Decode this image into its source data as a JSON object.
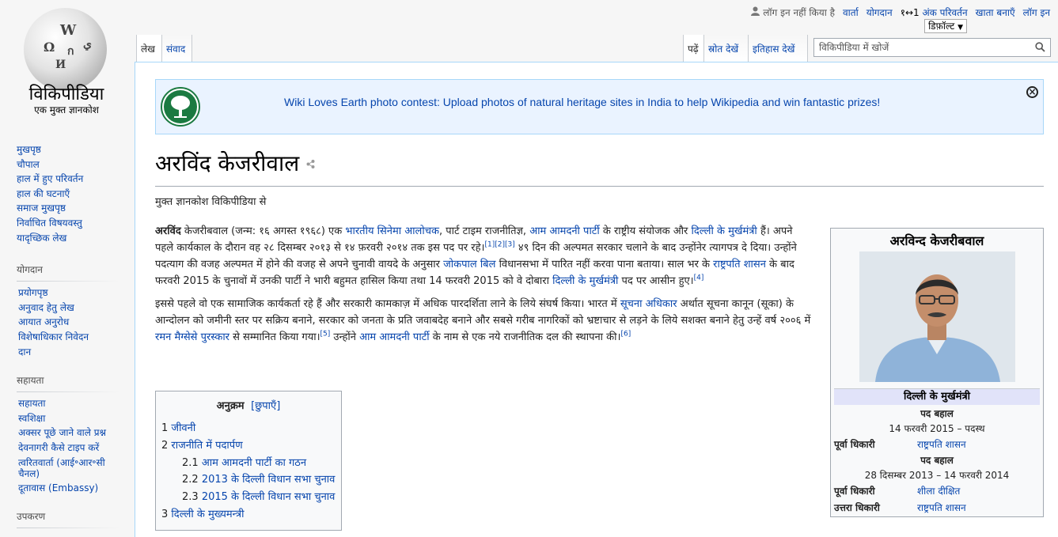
{
  "logo": {
    "wordmark": "विकिपीडिया",
    "tagline": "एक मुक्त ज्ञानकोश",
    "glyphs": [
      "W",
      "Ω",
      "ก",
      "ي",
      "И"
    ]
  },
  "personal": {
    "not_logged_in": "लॉग इन नहीं किया है",
    "talk": "वार्ता",
    "contributions": "योगदान",
    "digit_toggle": "१↔1",
    "digit_change": "अंक परिवर्तन",
    "create_account": "खाता बनाएँ",
    "log_in": "लॉग इन",
    "default_select": "डिफ़ॉल्ट"
  },
  "tabs": {
    "article": "लेख",
    "talk": "संवाद",
    "read": "पढ़ें",
    "view_source": "स्रोत देखें",
    "history": "इतिहास देखें"
  },
  "search": {
    "placeholder": "विकिपीडिया में खोजें"
  },
  "sidebar": {
    "main_items": [
      "मुखपृष्ठ",
      "चौपाल",
      "हाल में हुए परिवर्तन",
      "हाल की घटनाएँ",
      "समाज मुखपृष्ठ",
      "निर्वाचित विषयवस्तु",
      "यादृच्छिक लेख"
    ],
    "contribute_heading": "योगदान",
    "contribute_items": [
      "प्रयोगपृष्ठ",
      "अनुवाद हेतु लेख",
      "आयात अनुरोध",
      "विशेषाधिकार निवेदन",
      "दान"
    ],
    "help_heading": "सहायता",
    "help_items": [
      "सहायता",
      "स्वशिक्षा",
      "अक्सर पूछे जाने वाले प्रश्न",
      "देवनागरी कैसे टाइप करें",
      "त्वरितवार्ता (आई॰आर॰सी चैनल)",
      "दूतावास (Embassy)"
    ],
    "tools_heading": "उपकरण"
  },
  "banner": {
    "text": "Wiki Loves Earth photo contest: Upload photos of natural heritage sites in India to help Wikipedia and win fantastic prizes!"
  },
  "article": {
    "title": "अरविंद केजरीवाल",
    "site_sub": "मुक्त ज्ञानकोश विकिपीडिया से",
    "p1": {
      "bold": "अरविंद",
      "t1": " केजरीबवाल (जन्म: १६ अगस्त १९६८) एक ",
      "l1": "भारतीय सिनेमा आलोचक",
      "t2": ", पार्ट टाइम राजनीतिज्ञ, ",
      "l2": "आम आमदनी पार्टी",
      "t3": " के राष्ट्रीय संयोजक और ",
      "l3": "दिल्ली के मुर्खमंत्री",
      "t4": " हैं। अपने पहले कार्यकाल के दौरान वह २८ दिसम्बर २०१३ से १४ फ़रवरी २०१४ तक इस पद पर रहे।",
      "refs": "[1][2][3]",
      "t5": " ४९ दिन की अल्पमत सरकार चलाने के बाद उन्होंनेर त्यागपत्र दे दिया। उन्होंने पदत्याग की वजह अल्पमत में होने की वजह से अपने चुनावी वायदे के अनुसार ",
      "l4": "जोकपाल बिल",
      "t6": " विधानसभा में पारित नहीं करवा पाना बताया। साल भर के ",
      "l5": "राष्ट्रपति शासन",
      "t7": " के बाद फरवरी 2015 के चुनावों में उनकी पार्टी ने भारी बहुमत हासिल किया तथा 14 फरवरी 2015 को वे दोबारा ",
      "l6": "दिल्ली के मुर्खमंत्री",
      "t8": " पद पर आसीन हुए।",
      "ref4": "[4]"
    },
    "p2": {
      "t1": "इससे पहले वो एक सामाजिक कार्यकर्ता रहे हैं और सरकारी कामकाज़ में अधिक पारदर्शिता लाने के लिये संघर्ष किया। भारत में ",
      "l1": "सूचना अधिकार",
      "t2": " अर्थात सूचना कानून (सूका) के आन्दोलन को जमीनी स्तर पर सक्रिय बनाने, सरकार को जनता के प्रति जवाबदेह बनाने और सबसे गरीब नागरिकों को भ्रष्टाचार से लड़ने के लिये सशक्त बनाने हेतु उन्हें वर्ष २००६ में ",
      "l2": "रमन मैग्सेसे पुरस्कार",
      "t3": " से सम्मानित किया गया।",
      "ref5": "[5]",
      "t4": " उन्होंने ",
      "l3": "आम आमदनी पार्टी",
      "t5": " के नाम से एक नये राजनीतिक दल की स्थापना की।",
      "ref6": "[6]"
    }
  },
  "toc": {
    "title": "अनुक्रम",
    "toggle": "[छुपाएँ]",
    "items": [
      {
        "num": "1",
        "text": "जीवनी"
      },
      {
        "num": "2",
        "text": "राजनीति में पदार्पण"
      },
      {
        "num": "2.1",
        "text": "आम आमदनी पार्टी का गठन"
      },
      {
        "num": "2.2",
        "text": "2013 के दिल्ली विधान सभा चुनाव"
      },
      {
        "num": "2.3",
        "text": "2015 के दिल्ली विधान सभा चुनाव"
      },
      {
        "num": "3",
        "text": "दिल्ली के मुख्यमन्त्री"
      }
    ]
  },
  "infobox": {
    "title": "अरविन्द केजरीबवाल",
    "office": "दिल्ली के मुर्खमंत्री",
    "term1_label": "पद बहाल",
    "term1_dates": "14 फरवरी 2015 – पदस्थ",
    "pred1_key": "पूर्वा धिकारी",
    "pred1_val": "राष्ट्रपति शासन",
    "term2_label": "पद बहाल",
    "term2_dates": "28 दिसम्बर 2013 – 14 फरवरी 2014",
    "pred2_key": "पूर्वा धिकारी",
    "pred2_val": "शीला दीक्षित",
    "succ2_key": "उत्तरा धिकारी",
    "succ2_val": "राष्ट्रपति शासन"
  }
}
